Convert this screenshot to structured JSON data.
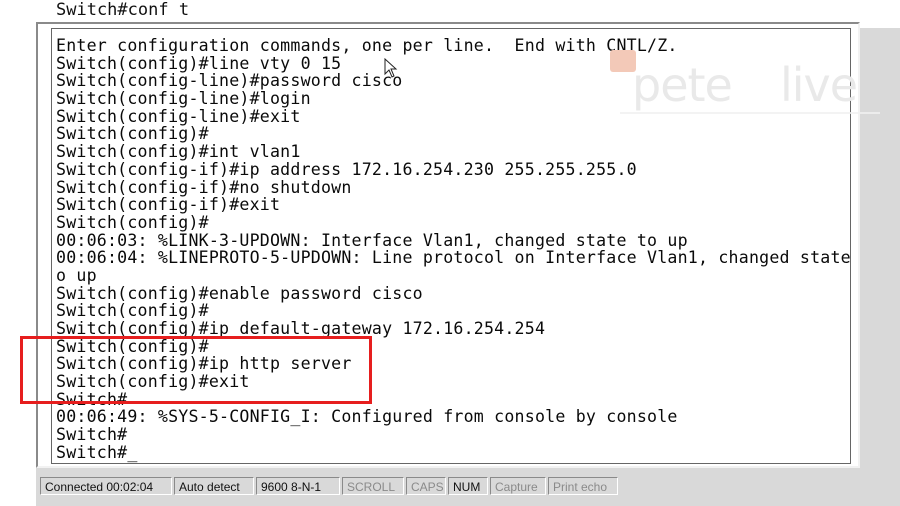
{
  "top_line": "Switch#conf t",
  "terminal": {
    "lines": [
      "Enter configuration commands, one per line.  End with CNTL/Z.",
      "Switch(config)#line vty 0 15",
      "Switch(config-line)#password cisco",
      "Switch(config-line)#login",
      "Switch(config-line)#exit",
      "Switch(config)#",
      "Switch(config)#int vlan1",
      "Switch(config-if)#ip address 172.16.254.230 255.255.255.0",
      "Switch(config-if)#no shutdown",
      "Switch(config-if)#exit",
      "Switch(config)#",
      "00:06:03: %LINK-3-UPDOWN: Interface Vlan1, changed state to up",
      "00:06:04: %LINEPROTO-5-UPDOWN: Line protocol on Interface Vlan1, changed state t",
      "o up",
      "Switch(config)#enable password cisco",
      "Switch(config)#",
      "Switch(config)#ip default-gateway 172.16.254.254",
      "Switch(config)#",
      "Switch(config)#ip http server",
      "Switch(config)#exit",
      "Switch#",
      "00:06:49: %SYS-5-CONFIG_I: Configured from console by console",
      "Switch#",
      "Switch#_"
    ]
  },
  "watermark": {
    "left": "pete",
    "right": "live",
    "accent_color": "#f3c9b8"
  },
  "highlight_color": "#e61e1e",
  "statusbar": {
    "connected": "Connected 00:02:04",
    "detect": "Auto detect",
    "port": "9600 8-N-1",
    "scroll": "SCROLL",
    "caps": "CAPS",
    "num": "NUM",
    "capture": "Capture",
    "print_echo": "Print echo"
  },
  "icons": {
    "cursor": "mouse-pointer-icon"
  }
}
